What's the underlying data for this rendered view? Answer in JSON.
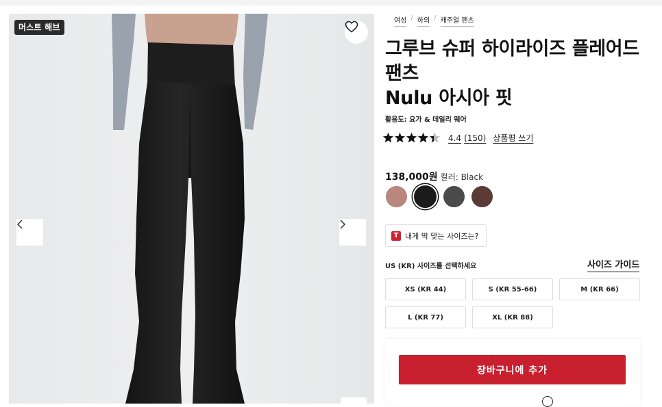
{
  "gallery": {
    "badge": "머스트 해브",
    "wishlist_icon": "heart-outline-icon",
    "prev_icon": "chevron-left-icon",
    "next_icon": "chevron-right-icon"
  },
  "breadcrumbs": [
    "여성",
    "하의",
    "캐주얼 팬츠"
  ],
  "product": {
    "title_line1": "그루브 슈퍼 하이라이즈 플레어드",
    "title_line2": "팬츠",
    "title_line3": "Nulu 아시아 핏",
    "activity": "활용도: 요가 & 데일리 웨어",
    "rating": {
      "stars": 4.4,
      "score": "4.4",
      "count": "(150)",
      "write_review": "상품평 쓰기"
    },
    "price": "138,000원",
    "color_label": "컬러: Black",
    "swatches": [
      {
        "name": "mauve",
        "color": "#b98780"
      },
      {
        "name": "black",
        "color": "#1b1b1b",
        "selected": true
      },
      {
        "name": "charcoal",
        "color": "#4b4b4b"
      },
      {
        "name": "espresso",
        "color": "#5a3b36"
      }
    ],
    "fit_button": "내게 딱 맞는 사이즈는?",
    "fit_badge": "T",
    "size_label": "US (KR) 사이즈를 선택하세요",
    "size_guide": "사이즈 가이드",
    "sizes": [
      "XS (KR 44)",
      "S (KR 55-66)",
      "M (KR 66)",
      "L (KR 77)",
      "XL (KR 88)"
    ],
    "add_to_cart": "장바구니에 추가"
  },
  "colors": {
    "accent": "#c8202f",
    "star": "#111111"
  }
}
